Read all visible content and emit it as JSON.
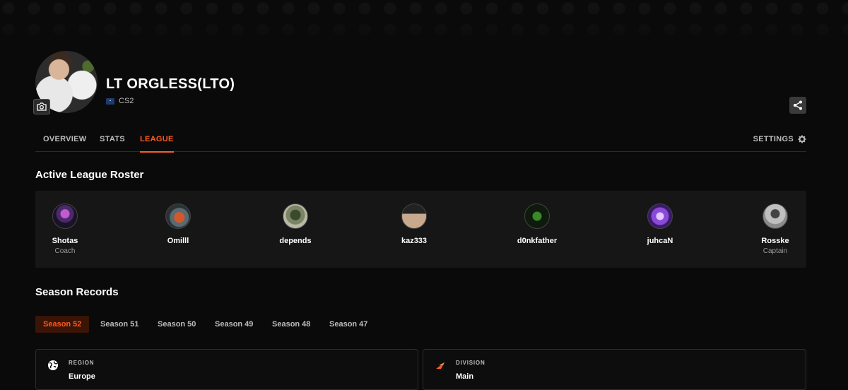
{
  "team": {
    "name": "LT ORGLESS(LTO)",
    "game": "CS2"
  },
  "tabs": [
    {
      "label": "OVERVIEW",
      "active": false
    },
    {
      "label": "STATS",
      "active": false
    },
    {
      "label": "LEAGUE",
      "active": true
    }
  ],
  "settings_label": "SETTINGS",
  "roster": {
    "title": "Active League Roster",
    "members": [
      {
        "name": "Shotas",
        "role": "Coach"
      },
      {
        "name": "Omilll",
        "role": ""
      },
      {
        "name": "depends",
        "role": ""
      },
      {
        "name": "kaz333",
        "role": ""
      },
      {
        "name": "d0nkfather",
        "role": ""
      },
      {
        "name": "juhcaN",
        "role": ""
      },
      {
        "name": "Rosske",
        "role": "Captain"
      }
    ]
  },
  "seasons": {
    "title": "Season Records",
    "items": [
      {
        "label": "Season 52",
        "active": true
      },
      {
        "label": "Season 51",
        "active": false
      },
      {
        "label": "Season 50",
        "active": false
      },
      {
        "label": "Season 49",
        "active": false
      },
      {
        "label": "Season 48",
        "active": false
      },
      {
        "label": "Season 47",
        "active": false
      }
    ]
  },
  "cards": {
    "region": {
      "label": "REGION",
      "value": "Europe",
      "icon": "globe-icon"
    },
    "division": {
      "label": "DIVISION",
      "value": "Main",
      "icon": "division-icon"
    }
  },
  "colors": {
    "accent": "#ff5a20",
    "background": "#0a0a0a",
    "panel": "#161616"
  }
}
